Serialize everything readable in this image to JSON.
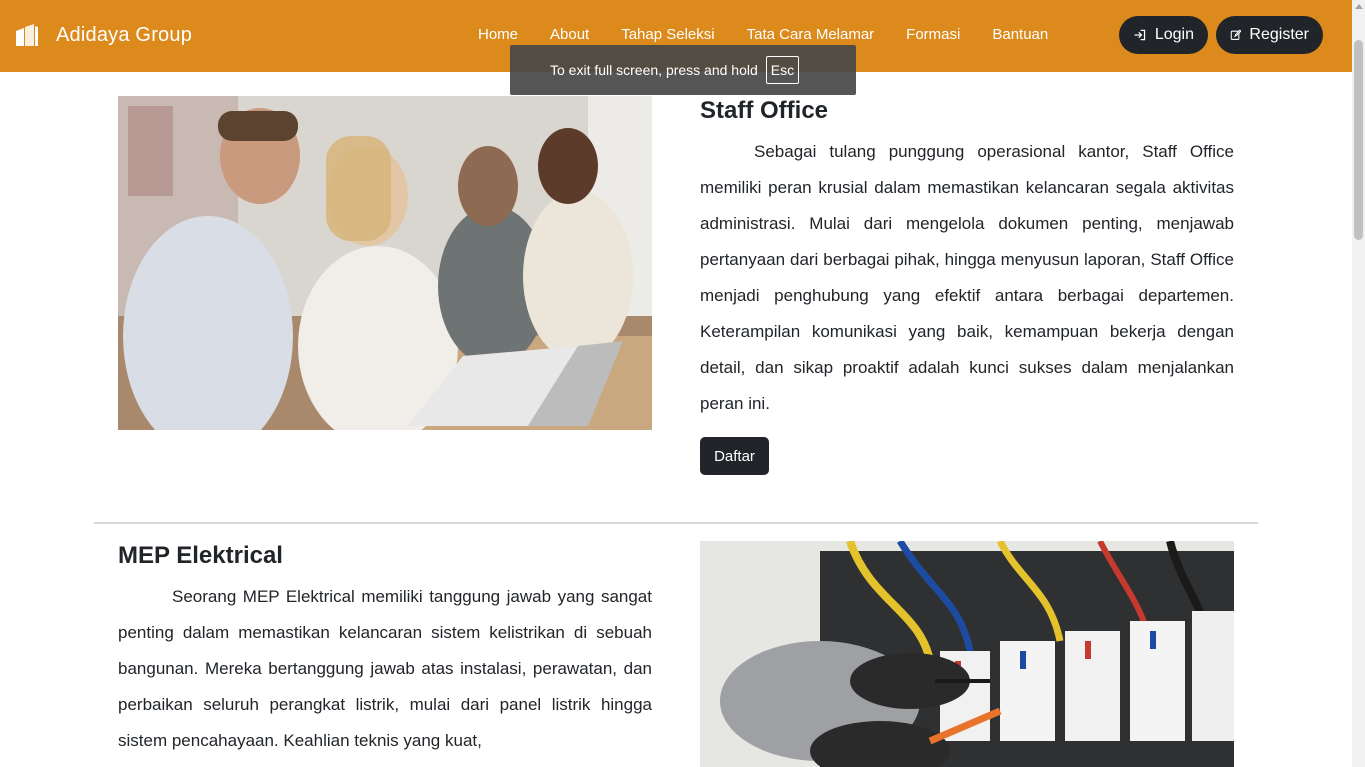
{
  "navbar": {
    "brand": "Adidaya Group",
    "links": [
      "Home",
      "About",
      "Tahap Seleksi",
      "Tata Cara Melamar",
      "Formasi",
      "Bantuan"
    ],
    "login_label": "Login",
    "register_label": "Register",
    "background": "#dc8a1c"
  },
  "fullscreen_toast": {
    "message": "To exit full screen, press and hold",
    "key": "Esc"
  },
  "jobs": [
    {
      "title": "Staff Office",
      "description": "Sebagai tulang punggung operasional kantor, Staff Office memiliki peran krusial dalam memastikan kelancaran segala aktivitas administrasi. Mulai dari mengelola dokumen penting, menjawab pertanyaan dari berbagai pihak, hingga menyusun laporan, Staff Office menjadi penghubung yang efektif antara berbagai departemen. Keterampilan komunikasi yang baik, kemampuan bekerja dengan detail, dan sikap proaktif adalah kunci sukses dalam menjalankan peran ini.",
      "button_label": "Daftar"
    },
    {
      "title": "MEP Elektrical",
      "description": "Seorang MEP Elektrical memiliki tanggung jawab yang sangat penting dalam memastikan kelancaran sistem kelistrikan di sebuah bangunan. Mereka bertanggung jawab atas instalasi, perawatan, dan perbaikan seluruh perangkat listrik, mulai dari panel listrik hingga sistem pencahayaan. Keahlian teknis yang kuat,"
    }
  ],
  "colors": {
    "dark": "#212529",
    "accent": "#dc8a1c"
  }
}
